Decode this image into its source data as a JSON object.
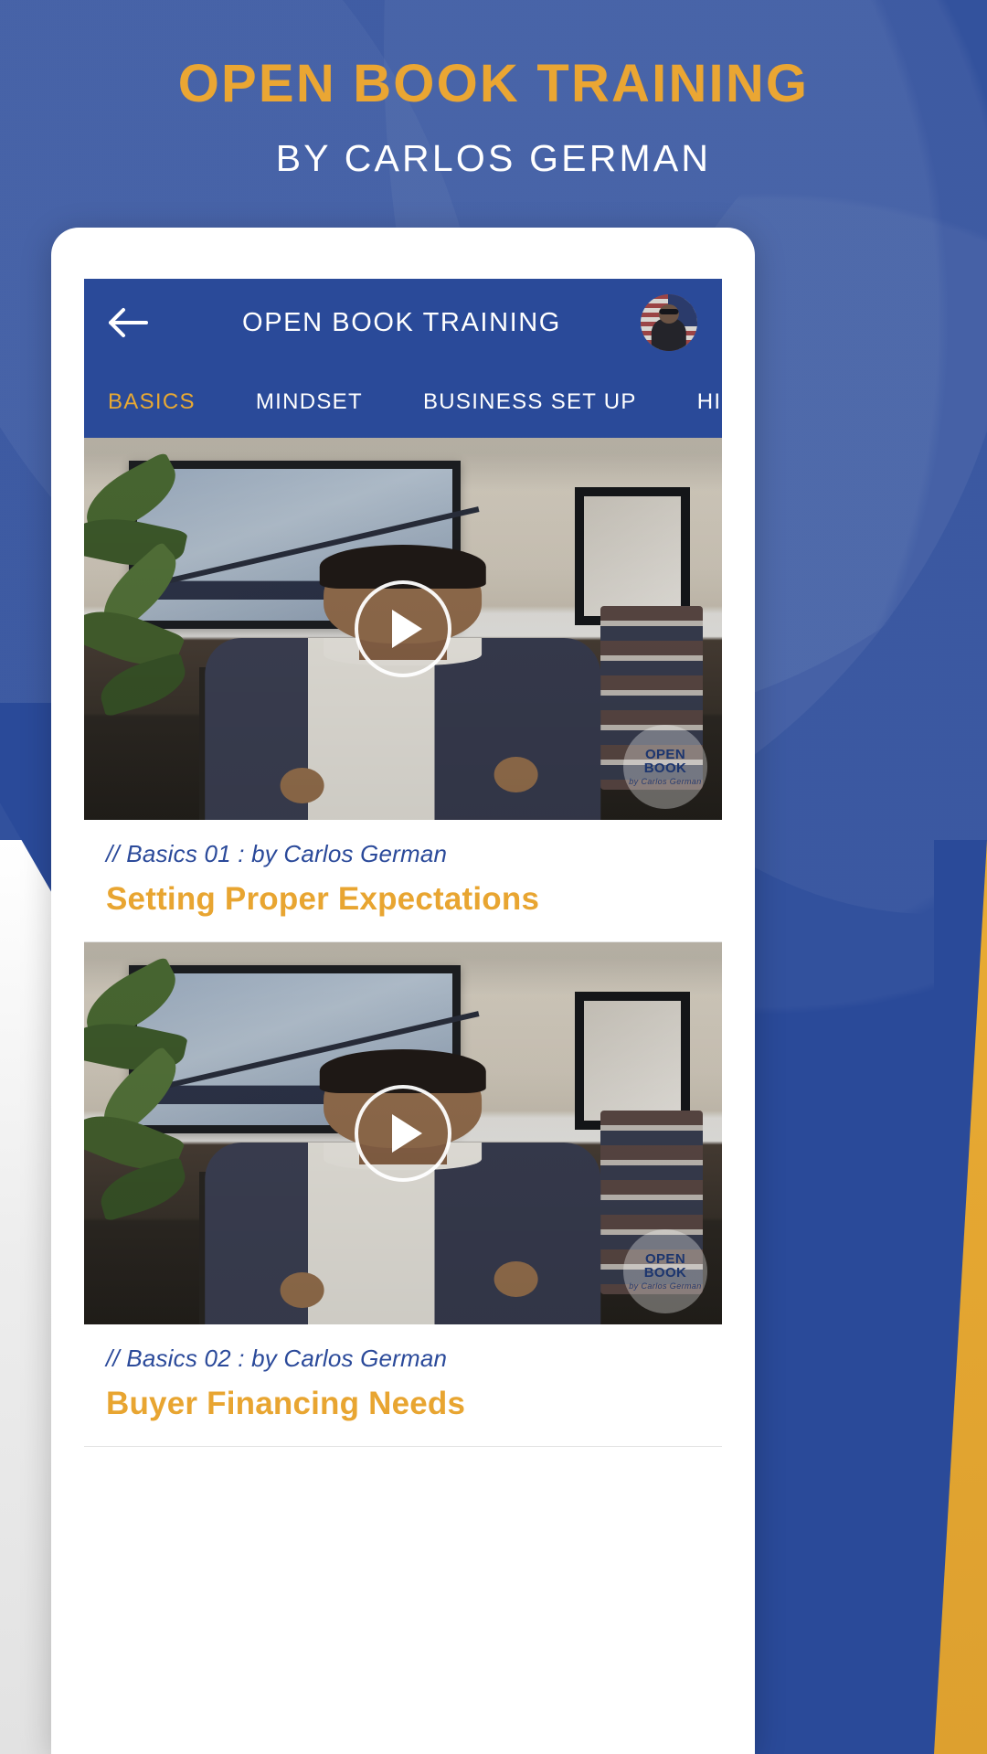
{
  "promo": {
    "title": "OPEN BOOK TRAINING",
    "subtitle": "BY CARLOS GERMAN"
  },
  "colors": {
    "brand_blue": "#2a4a99",
    "accent_gold": "#e9a932",
    "title_gold": "#eaa633",
    "white": "#ffffff"
  },
  "app": {
    "appbar": {
      "back_icon": "arrow-left-icon",
      "title": "OPEN BOOK TRAINING",
      "avatar_alt": "user-avatar"
    },
    "tabs": [
      {
        "label": "BASICS",
        "active": true
      },
      {
        "label": "MINDSET",
        "active": false
      },
      {
        "label": "BUSINESS SET UP",
        "active": false
      },
      {
        "label": "HIRING ASSISTAN",
        "active": false
      }
    ],
    "videos": [
      {
        "meta": "// Basics 01 : by Carlos German",
        "title": "Setting Proper Expectations",
        "play_icon": "play-icon",
        "watermark_line1": "OPEN",
        "watermark_line2": "BOOK",
        "watermark_sig": "by Carlos German"
      },
      {
        "meta": "// Basics 02 : by Carlos German",
        "title": "Buyer Financing Needs",
        "play_icon": "play-icon",
        "watermark_line1": "OPEN",
        "watermark_line2": "BOOK",
        "watermark_sig": "by Carlos German"
      }
    ]
  }
}
